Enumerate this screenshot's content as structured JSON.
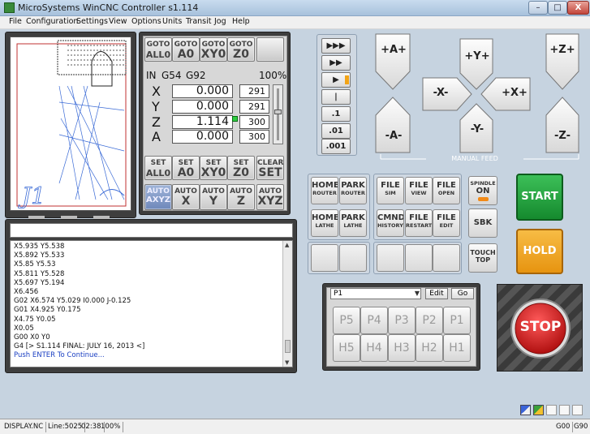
{
  "window": {
    "title": "MicroSystems WinCNC Controller s1.114",
    "minimize": "–",
    "maximize": "□",
    "close": "X"
  },
  "menu": [
    "File",
    "Configuration",
    "Settings",
    "View",
    "Options",
    "Units",
    "Transit",
    "Jog",
    "Help"
  ],
  "goto_buttons": [
    {
      "l1": "GOTO",
      "l2": "ALL0"
    },
    {
      "l1": "GOTO",
      "l2": "A0"
    },
    {
      "l1": "GOTO",
      "l2": "XY0"
    },
    {
      "l1": "GOTO",
      "l2": "Z0"
    }
  ],
  "dro": {
    "units": "IN",
    "coord1": "G54",
    "coord2": "G92",
    "percent": "100%",
    "axes": [
      {
        "label": "X",
        "value": "0.000",
        "feed": "291"
      },
      {
        "label": "Y",
        "value": "0.000",
        "feed": "291"
      },
      {
        "label": "Z",
        "value": "1.114",
        "feed": "300"
      },
      {
        "label": "A",
        "value": "0.000",
        "feed": "300"
      }
    ]
  },
  "set_buttons": [
    {
      "l1": "SET",
      "l2": "ALL0"
    },
    {
      "l1": "SET",
      "l2": "A0"
    },
    {
      "l1": "SET",
      "l2": "XY0"
    },
    {
      "l1": "SET",
      "l2": "Z0"
    },
    {
      "l1": "CLEAR",
      "l2": "SET"
    }
  ],
  "auto_buttons": [
    {
      "l1": "AUTO",
      "l2": "AXYZ"
    },
    {
      "l1": "AUTO",
      "l2": "X"
    },
    {
      "l1": "AUTO",
      "l2": "Y"
    },
    {
      "l1": "AUTO",
      "l2": "Z"
    },
    {
      "l1": "AUTO",
      "l2": "XYZ"
    }
  ],
  "feed_buttons": [
    "▶▶▶",
    "▶▶",
    "▶",
    "|",
    ".1",
    ".01",
    ".001"
  ],
  "jog": {
    "a_plus": "+A+",
    "a_minus": "-A-",
    "y_plus": "+Y+",
    "y_minus": "-Y-",
    "x_minus": "-X-",
    "x_plus": "+X+",
    "z_plus": "+Z+",
    "z_minus": "-Z-",
    "manual_feed_label": "MANUAL FEED"
  },
  "cmd_buttons": {
    "home_router": {
      "t1": "HOME",
      "t2": "ROUTER"
    },
    "park_router": {
      "t1": "PARK",
      "t2": "ROUTER"
    },
    "file_sim": {
      "t1": "FILE",
      "t2": "SIM"
    },
    "file_view": {
      "t1": "FILE",
      "t2": "VIEW"
    },
    "file_open": {
      "t1": "FILE",
      "t2": "OPEN"
    },
    "spindle_on": {
      "t1": "SPINDLE",
      "t2": "ON"
    },
    "home_lathe": {
      "t1": "HOME",
      "t2": "LATHE"
    },
    "park_lathe": {
      "t1": "PARK",
      "t2": "LATHE"
    },
    "cmnd_history": {
      "t1": "CMND",
      "t2": "HISTORY"
    },
    "file_restart": {
      "t1": "FILE",
      "t2": "RESTART"
    },
    "file_edit": {
      "t1": "FILE",
      "t2": "EDIT"
    },
    "sbk": {
      "t1": "SBK"
    },
    "touch_top": {
      "t1": "TOUCH",
      "t2": "TOP"
    }
  },
  "start_label": "START",
  "hold_label": "HOLD",
  "stop_label": "STOP",
  "presets": {
    "selected": "P1",
    "edit_label": "Edit",
    "go_label": "Go",
    "row1": [
      "P5",
      "P4",
      "P3",
      "P2",
      "P1"
    ],
    "row2": [
      "H5",
      "H4",
      "H3",
      "H2",
      "H1"
    ]
  },
  "command_input": {
    "value": ""
  },
  "console_lines": [
    "X5.935 Y5.538",
    "X5.892 Y5.533",
    "X5.85 Y5.53",
    "X5.811 Y5.528",
    "X5.697 Y5.194",
    "X6.456",
    "G02 X6.574 Y5.029 I0.000 J-0.125",
    "G01 X4.925 Y0.175",
    "X4.75 Y0.05",
    "X0.05",
    "G00 X0 Y0",
    "G4 [> S1.114 FINAL: JULY 16, 2013 <]",
    "Push ENTER To Continue..."
  ],
  "status": {
    "file": "DISPLAY.NC",
    "line": "Line:5025",
    "time": "02:38",
    "percent": "100%",
    "g1": "G00",
    "g2": "G90"
  },
  "colors": {
    "start": "#1e9a3a",
    "hold": "#f2a417",
    "stop": "#d82020",
    "background": "#c6d3e0"
  }
}
